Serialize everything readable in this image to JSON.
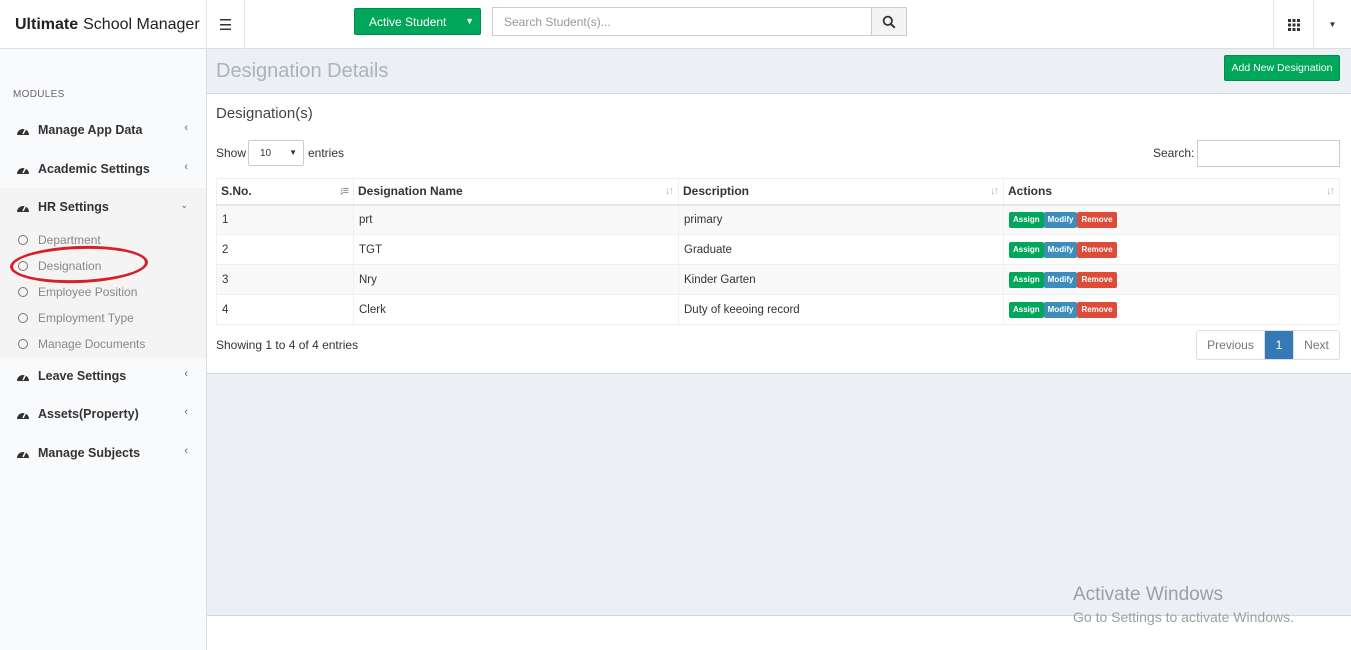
{
  "header": {
    "brand_bold": "Ultimate",
    "brand_rest": "School Manager",
    "active_student_label": "Active Student",
    "search_placeholder": "Search Student(s)..."
  },
  "sidebar": {
    "section_label": "MODULES",
    "items": [
      {
        "label": "Manage App Data",
        "icon": "dashboard-icon"
      },
      {
        "label": "Academic Settings",
        "icon": "dashboard-icon"
      },
      {
        "label": "HR Settings",
        "icon": "dashboard-icon"
      },
      {
        "label": "Leave Settings",
        "icon": "dashboard-icon"
      },
      {
        "label": "Assets(Property)",
        "icon": "dashboard-icon"
      },
      {
        "label": "Manage Subjects",
        "icon": "dashboard-icon"
      }
    ],
    "hr_sub_items": [
      "Department",
      "Designation",
      "Employee Position",
      "Employment Type",
      "Manage Documents"
    ]
  },
  "content": {
    "page_title": "Designation Details",
    "add_button": "Add New Designation",
    "box_title": "Designation(s)",
    "show_label": "Show",
    "page_length": "10",
    "entries_label": "entries",
    "search_label": "Search:",
    "columns": [
      "S.No.",
      "Designation Name",
      "Description",
      "Actions"
    ],
    "rows": [
      {
        "sno": "1",
        "name": "prt",
        "description": "primary"
      },
      {
        "sno": "2",
        "name": "TGT",
        "description": "Graduate"
      },
      {
        "sno": "3",
        "name": "Nry",
        "description": "Kinder Garten"
      },
      {
        "sno": "4",
        "name": "Clerk",
        "description": "Duty of keeoing record"
      }
    ],
    "actions": {
      "assign": "Assign",
      "modify": "Modify",
      "remove": "Remove"
    },
    "info": "Showing 1 to 4 of 4 entries",
    "pager": {
      "previous": "Previous",
      "current": "1",
      "next": "Next"
    }
  },
  "watermark": {
    "line1": "Activate Windows",
    "line2": "Go to Settings to activate Windows."
  },
  "colors": {
    "success": "#00a65a",
    "primary": "#3c8dbc",
    "danger": "#dd4b39",
    "annotation": "#d81f27"
  }
}
